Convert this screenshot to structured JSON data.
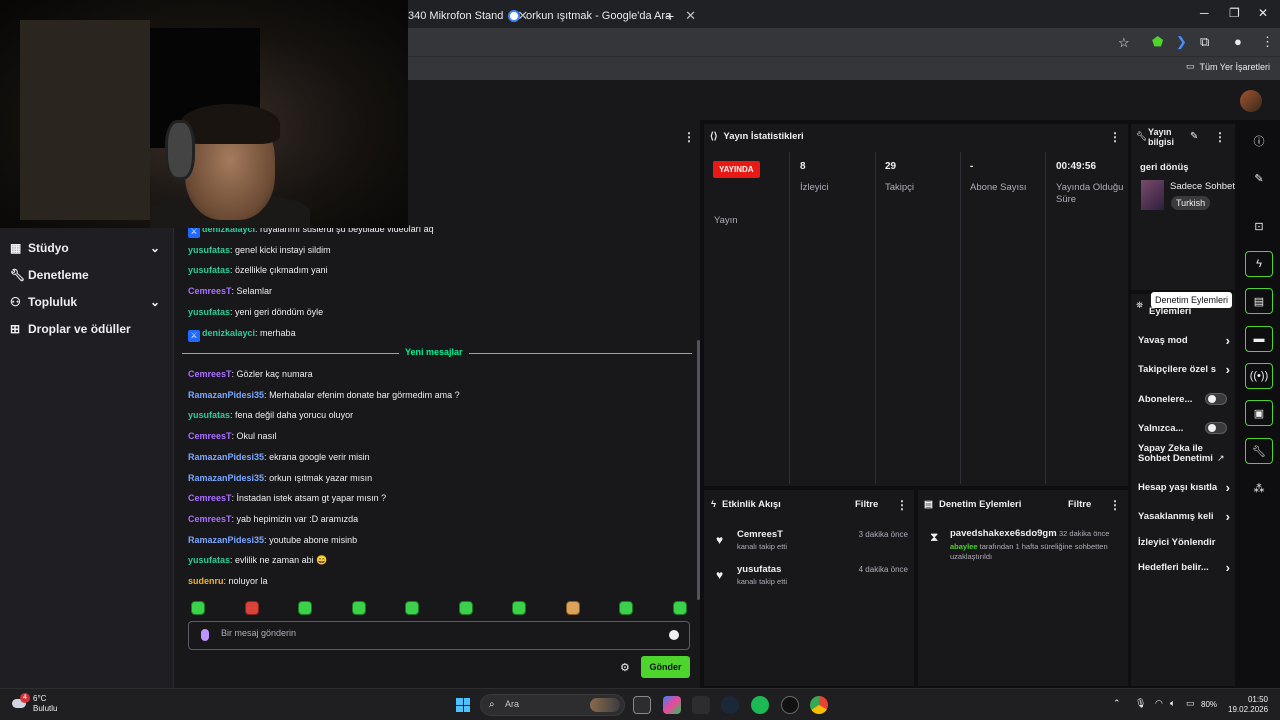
{
  "browser": {
    "tabs": [
      {
        "label": "340 Mikrofon Stand"
      },
      {
        "label": "orkun ışıtmak - Google'da Ara"
      }
    ],
    "new_tab_icon": "plus-icon",
    "bookmarks_label": "Tüm Yer İşaretleri"
  },
  "leftnav": {
    "items": [
      {
        "label": "Stüdyo",
        "icon": "film-icon",
        "expandable": true
      },
      {
        "label": "Denetleme",
        "icon": "wrench-icon",
        "expandable": false
      },
      {
        "label": "Topluluk",
        "icon": "people-icon",
        "expandable": true
      },
      {
        "label": "Droplar ve ödüller",
        "icon": "gift-icon",
        "expandable": false
      }
    ]
  },
  "chat": {
    "messages": [
      {
        "user": "denizkalayci",
        "text": "rüyalarımı süslerdi şu beyblade videoları aq",
        "color": "#2ecc9a",
        "badge": true
      },
      {
        "user": "yusufatas",
        "text": "genel kicki instayi sildim",
        "color": "#2ecc9a",
        "badge": false
      },
      {
        "user": "yusufatas",
        "text": "özellikle çıkmadım yani",
        "color": "#2ecc9a",
        "badge": false
      },
      {
        "user": "CemreesT",
        "text": "Selamlar",
        "color": "#a970ff",
        "badge": false
      },
      {
        "user": "yusufatas",
        "text": "yeni geri döndüm öyle",
        "color": "#2ecc9a",
        "badge": false
      },
      {
        "user": "denizkalayci",
        "text": "merhaba",
        "color": "#2ecc9a",
        "badge": true
      }
    ],
    "divider_label": "Yeni mesajlar",
    "new_messages": [
      {
        "user": "CemreesT",
        "text": "Gözler kaç numara",
        "color": "#a970ff"
      },
      {
        "user": "RamazanPidesi35",
        "text": "Merhabalar efenim donate bar görmedim ama ?",
        "color": "#7aa7ff"
      },
      {
        "user": "yusufatas",
        "text": "fena değil daha yorucu oluyor",
        "color": "#2ecc9a"
      },
      {
        "user": "CemreesT",
        "text": "Okul nasıl",
        "color": "#a970ff"
      },
      {
        "user": "RamazanPidesi35",
        "text": "ekrana google verir misin",
        "color": "#7aa7ff"
      },
      {
        "user": "RamazanPidesi35",
        "text": "orkun ışıtmak yazar mısın",
        "color": "#7aa7ff"
      },
      {
        "user": "CemreesT",
        "text": "İnstadan istek atsam gt yapar mısın ?",
        "color": "#a970ff"
      },
      {
        "user": "CemreesT",
        "text": "yab hepimizin var :D aramızda",
        "color": "#a970ff"
      },
      {
        "user": "RamazanPidesi35",
        "text": "youtube abone misinb",
        "color": "#7aa7ff"
      },
      {
        "user": "yusufatas",
        "text": "evlilik ne zaman abi 😄",
        "color": "#2ecc9a"
      },
      {
        "user": "sudenru",
        "text": "noluyor la",
        "color": "#f0b030"
      }
    ],
    "input_placeholder": "Bir mesaj gönderin",
    "send_label": "Gönder"
  },
  "stats": {
    "title": "Yayın İstatistikleri",
    "live_badge": "YAYINDA",
    "columns": [
      {
        "value": "",
        "label": "Yayın"
      },
      {
        "value": "8",
        "label": "İzleyici"
      },
      {
        "value": "29",
        "label": "Takipçi"
      },
      {
        "value": "-",
        "label": "Abone Sayısı"
      },
      {
        "value": "00:49:56",
        "label": "Yayında Olduğu Süre"
      }
    ]
  },
  "activity": {
    "title": "Etkinlik Akışı",
    "filter_label": "Filtre",
    "items": [
      {
        "name": "CemreesT",
        "time": "3 dakika önce",
        "desc": "kanalı takip etti"
      },
      {
        "name": "yusufatas",
        "time": "4 dakika önce",
        "desc": "kanalı takip etti"
      }
    ]
  },
  "modactions": {
    "title": "Denetim Eylemleri",
    "filter_label": "Filtre",
    "entry": {
      "name": "pavedshakexe6sdo9gm",
      "time": "32 dakika önce",
      "moderator": "abaylee",
      "text": "tarafından 1 hafta süreliğine sohbetten uzaklaştırıldı"
    }
  },
  "streaminfo": {
    "title": "Yayın bilgisi",
    "stream_title": "geri dönüş",
    "category": "Sadece Sohbet",
    "tag": "Turkish"
  },
  "modlist": {
    "header": "Eylemleri",
    "rows": [
      {
        "label": "Yavaş mod",
        "kind": "arrow"
      },
      {
        "label": "Takipçilere özel s",
        "kind": "arrow"
      },
      {
        "label": "Abonelere...",
        "kind": "toggle"
      },
      {
        "label": "Yalnızca...",
        "kind": "toggle"
      },
      {
        "label": "Yapay Zeka ile Sohbet Denetimi",
        "kind": "external"
      },
      {
        "label": "Hesap yaşı kısıtla",
        "kind": "arrow"
      },
      {
        "label": "Yasaklanmış keli",
        "kind": "arrow"
      },
      {
        "label": "İzleyici Yönlendir",
        "kind": "none"
      },
      {
        "label": "Hedefleri belir...",
        "kind": "arrow"
      }
    ]
  },
  "rail": {
    "tooltip": "Denetim Eylemleri"
  },
  "taskbar": {
    "weather_temp": "6°C",
    "weather_desc": "Bulutlu",
    "weather_badge": "4",
    "search_placeholder": "Ara",
    "battery": "80%",
    "time": "01:50",
    "date": "19.02.2026"
  },
  "colors": {
    "accent_green": "#4dd42d",
    "live_red": "#e91916",
    "divider_green": "#00f593"
  }
}
